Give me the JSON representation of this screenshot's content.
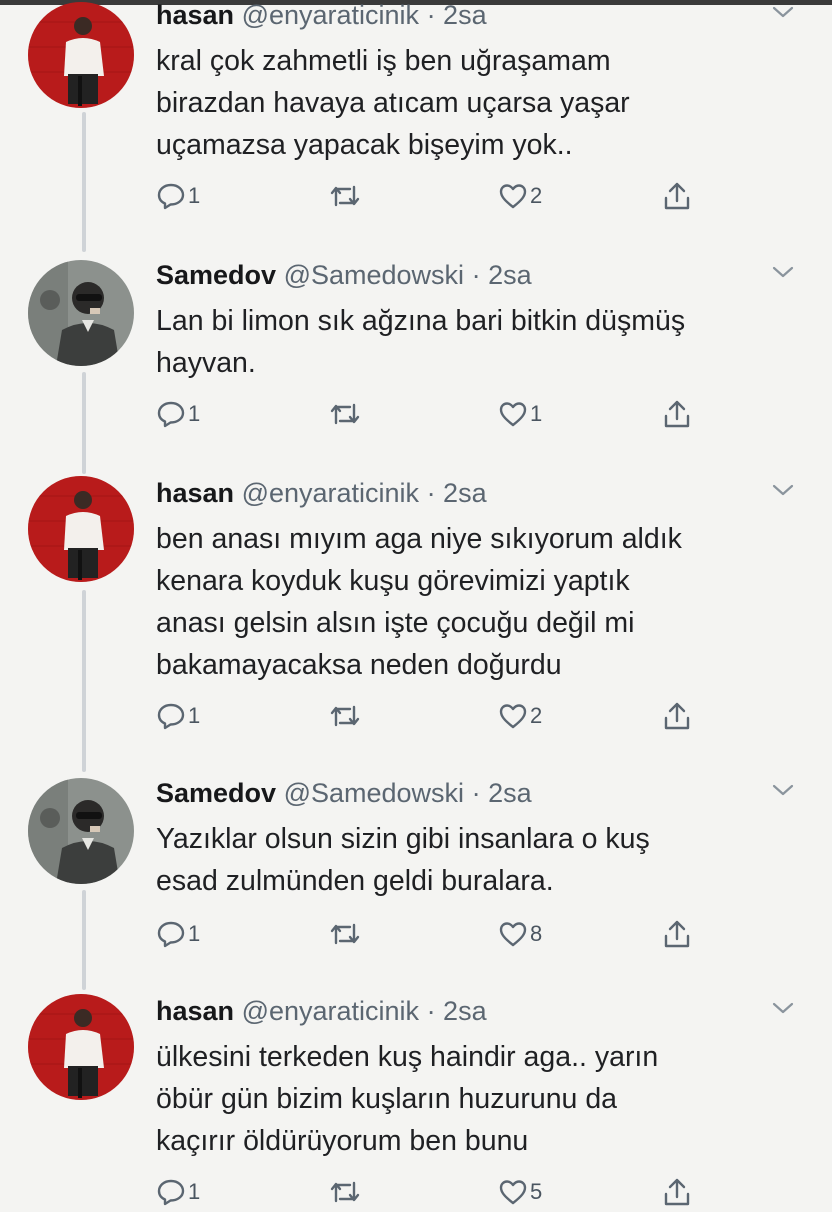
{
  "tweets": [
    {
      "name": "hasan",
      "handle": "@enyaraticinik",
      "time": "· 2sa",
      "text": "kral çok zahmetli iş ben uğraşamam\nbirazdan havaya atıcam uçarsa yaşar\nuçamazsa yapacak bişeyim yok..",
      "replies": "1",
      "retweets": "",
      "likes": "2",
      "avatar": "hasan-avatar"
    },
    {
      "name": "Samedov",
      "handle": "@Samedowski",
      "time": "· 2sa",
      "text": "Lan bi limon sık ağzına bari bitkin düşmüş\nhayvan.",
      "replies": "1",
      "retweets": "",
      "likes": "1",
      "avatar": "samedov-avatar"
    },
    {
      "name": "hasan",
      "handle": "@enyaraticinik",
      "time": "· 2sa",
      "text": "ben anası mıyım aga niye sıkıyorum aldık\nkenara koyduk kuşu görevimizi yaptık\nanası gelsin alsın işte çocuğu değil mi\nbakamayacaksa neden doğurdu",
      "replies": "1",
      "retweets": "",
      "likes": "2",
      "avatar": "hasan-avatar"
    },
    {
      "name": "Samedov",
      "handle": "@Samedowski",
      "time": "· 2sa",
      "text": "Yazıklar olsun sizin gibi insanlara o kuş\nesad zulmünden geldi buralara.",
      "replies": "1",
      "retweets": "",
      "likes": "8",
      "avatar": "samedov-avatar"
    },
    {
      "name": "hasan",
      "handle": "@enyaraticinik",
      "time": "· 2sa",
      "text": "ülkesini terkeden kuş haindir aga.. yarın\nöbür gün bizim kuşların huzurunu da\nkaçırır öldürüyorum ben bunu",
      "replies": "1",
      "retweets": "",
      "likes": "5",
      "avatar": "hasan-avatar"
    }
  ],
  "icons": {
    "reply": "reply-icon",
    "retweet": "retweet-icon",
    "like": "heart-icon",
    "share": "share-icon",
    "menu": "chevron-down-icon"
  },
  "colors": {
    "background": "#f4f4f2",
    "icon_gray": "#5b6671",
    "thread_line": "#cfd3d7",
    "hasan_avatar_bg": "#c0201c",
    "samedov_avatar_bg": "#8c918d"
  }
}
